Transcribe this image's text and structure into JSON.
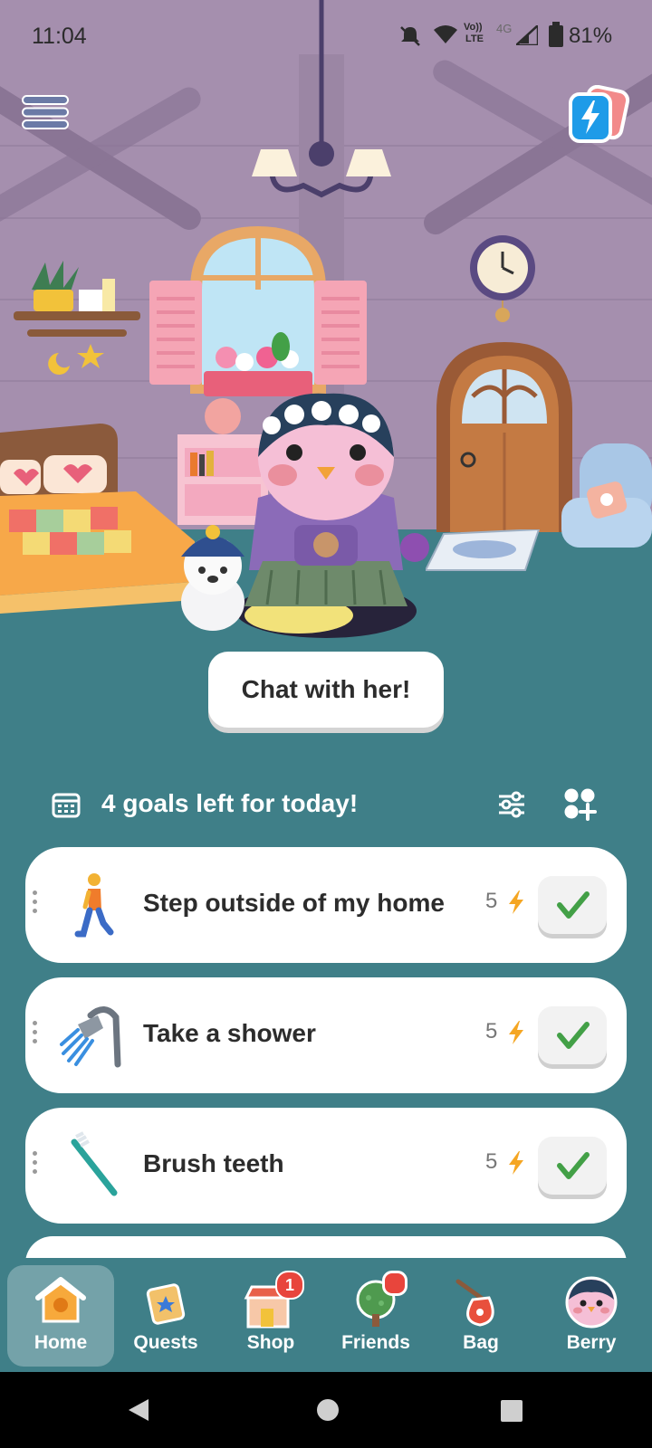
{
  "status_bar": {
    "time": "11:04",
    "network_labels": [
      "Vo))",
      "LTE",
      "4G"
    ],
    "battery": "81%"
  },
  "scene": {
    "chat_button_label": "Chat with her!"
  },
  "goals": {
    "header": "4 goals left for today!",
    "items": [
      {
        "title": "Step outside of my home",
        "points": "5",
        "icon": "walking-person-icon"
      },
      {
        "title": "Take a shower",
        "points": "5",
        "icon": "shower-icon"
      },
      {
        "title": "Brush teeth",
        "points": "5",
        "icon": "toothbrush-icon"
      }
    ]
  },
  "bottom_nav": {
    "items": [
      {
        "label": "Home",
        "icon": "home-icon",
        "active": true
      },
      {
        "label": "Quests",
        "icon": "quests-icon"
      },
      {
        "label": "Shop",
        "icon": "shop-icon",
        "badge": "1"
      },
      {
        "label": "Friends",
        "icon": "friends-tree-icon",
        "dot": true
      },
      {
        "label": "Bag",
        "icon": "bag-icon"
      },
      {
        "label": "Berry",
        "icon": "berry-avatar-icon"
      }
    ]
  },
  "colors": {
    "background_teal": "#3f7f88",
    "bolt_orange": "#f5a623",
    "check_green": "#43a047",
    "badge_red": "#e8453c"
  }
}
